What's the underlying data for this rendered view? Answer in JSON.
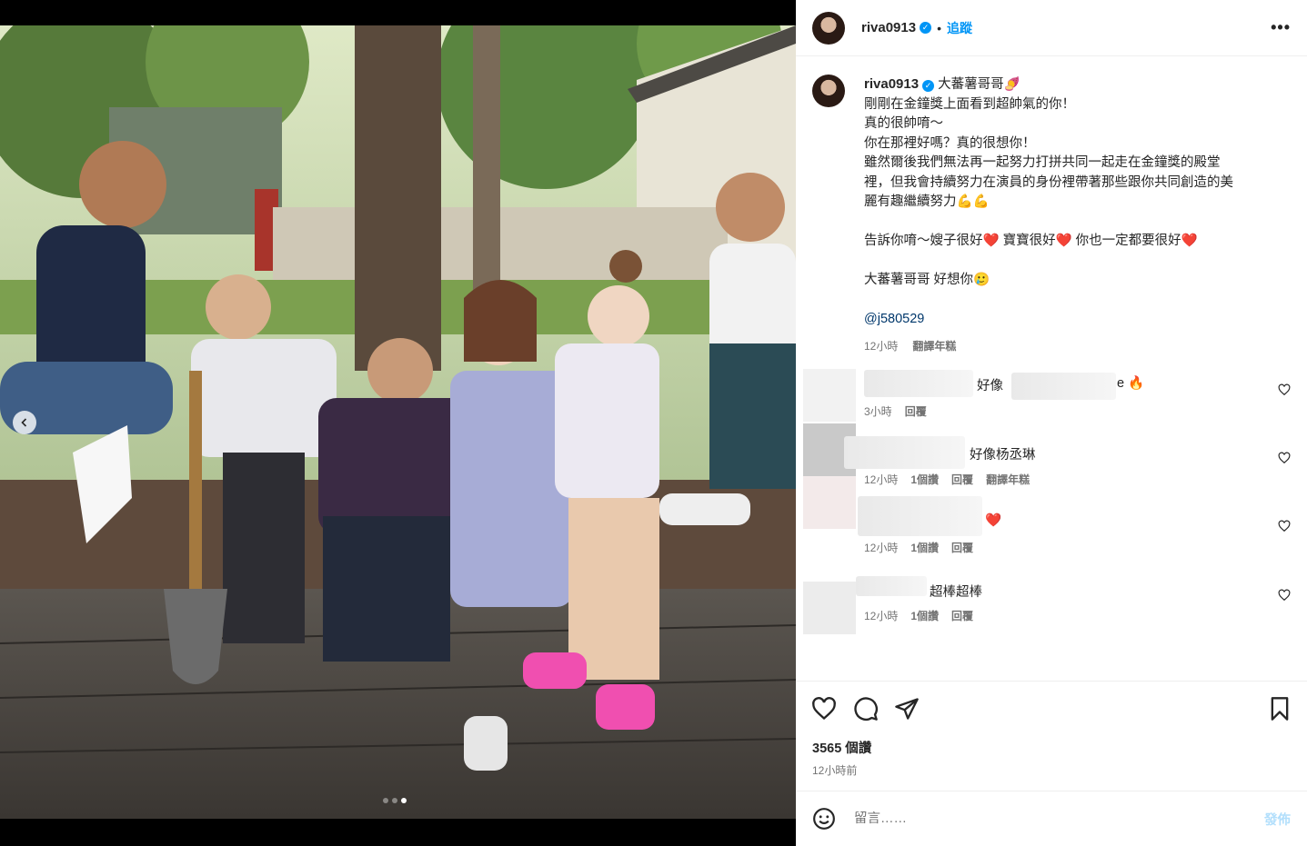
{
  "header": {
    "username": "riva0913",
    "separator": "•",
    "follow_label": "追蹤",
    "more_label": "•••"
  },
  "caption": {
    "username": "riva0913",
    "lines": [
      "大蕃薯哥哥🍠",
      "剛剛在金鐘獎上面看到超帥氣的你！",
      "真的很帥唷～",
      "你在那裡好嗎？真的很想你！",
      "雖然爾後我們無法再一起努力打拼共同一起走在金鐘獎的殿堂",
      "裡，但我會持續努力在演員的身份裡帶著那些跟你共同創造的美",
      "麗有趣繼續努力💪💪",
      "",
      "告訴你唷～嫂子很好❤️ 寶寶很好❤️ 你也一定都要很好❤️",
      "",
      "大蕃薯哥哥 好想你🥲",
      ""
    ],
    "mention": "@j580529",
    "time": "12小時",
    "translate": "翻譯年糕"
  },
  "comments": [
    {
      "text_before": "好像",
      "text_after": "e 🔥",
      "time": "3小時",
      "likes": "",
      "reply": "回覆",
      "translate": ""
    },
    {
      "text_before": "好像杨丞琳",
      "text_after": "",
      "time": "12小時",
      "likes": "1個讚",
      "reply": "回覆",
      "translate": "翻譯年糕"
    },
    {
      "text_before": "❤️",
      "text_after": "",
      "time": "12小時",
      "likes": "1個讚",
      "reply": "回覆",
      "translate": ""
    },
    {
      "text_before": "超棒超棒",
      "text_after": "",
      "time": "12小時",
      "likes": "1個讚",
      "reply": "回覆",
      "translate": ""
    }
  ],
  "actions": {
    "like_icon": "heart-icon",
    "comment_icon": "comment-icon",
    "share_icon": "send-icon",
    "save_icon": "bookmark-icon"
  },
  "likes": "3565 個讚",
  "posted": "12小時前",
  "add_comment": {
    "placeholder": "留言……",
    "post_label": "發佈",
    "emoji_icon": "emoji-icon"
  },
  "carousel": {
    "slide_count": 3,
    "active_index": 2
  },
  "colors": {
    "link": "#0095f6",
    "muted": "#737373",
    "border": "#efefef"
  }
}
